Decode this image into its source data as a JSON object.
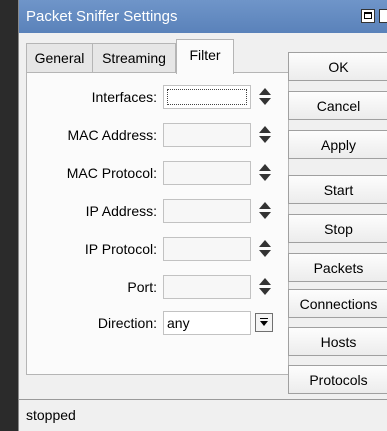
{
  "window": {
    "title": "Packet Sniffer Settings"
  },
  "tabs": [
    {
      "label": "General",
      "active": false
    },
    {
      "label": "Streaming",
      "active": false
    },
    {
      "label": "Filter",
      "active": true
    }
  ],
  "filter": {
    "interfaces": {
      "label": "Interfaces:",
      "value": ""
    },
    "mac_address": {
      "label": "MAC Address:",
      "value": ""
    },
    "mac_protocol": {
      "label": "MAC Protocol:",
      "value": ""
    },
    "ip_address": {
      "label": "IP Address:",
      "value": ""
    },
    "ip_protocol": {
      "label": "IP Protocol:",
      "value": ""
    },
    "port": {
      "label": "Port:",
      "value": ""
    },
    "direction": {
      "label": "Direction:",
      "value": "any"
    }
  },
  "buttons": {
    "ok": "OK",
    "cancel": "Cancel",
    "apply": "Apply",
    "start": "Start",
    "stop": "Stop",
    "packets": "Packets",
    "connections": "Connections",
    "hosts": "Hosts",
    "protocols": "Protocols"
  },
  "status": {
    "text": "stopped"
  },
  "colors": {
    "titlebar": "#5f88c0",
    "panel": "#fbfbfb",
    "window": "#f0f0f0"
  }
}
